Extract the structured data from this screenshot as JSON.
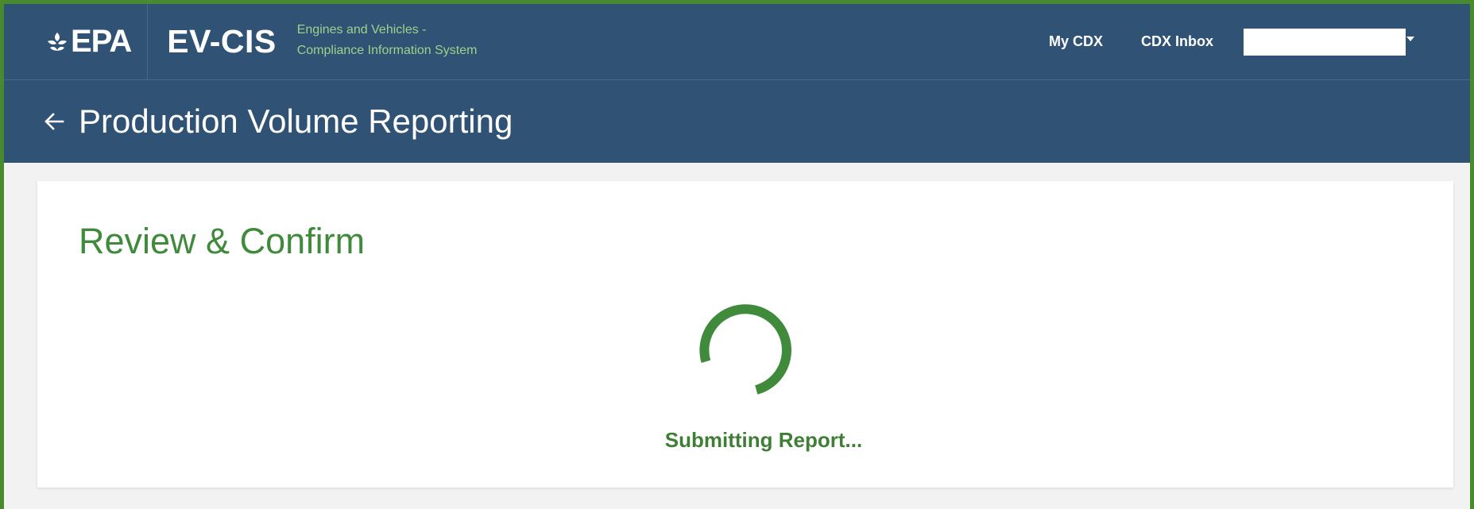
{
  "header": {
    "agency_logo": "EPA",
    "app_name": "EV-CIS",
    "app_subtitle_line1": "Engines and Vehicles -",
    "app_subtitle_line2": "Compliance Information System",
    "nav": {
      "my_cdx": "My CDX",
      "cdx_inbox": "CDX Inbox"
    },
    "user_menu_value": ""
  },
  "page": {
    "back_icon": "arrow-left-icon",
    "title": "Production Volume Reporting"
  },
  "main": {
    "section_title": "Review & Confirm",
    "spinner_icon": "loading-spinner-icon",
    "status_text": "Submitting Report..."
  },
  "colors": {
    "frame_border": "#4a8a2f",
    "header_bg": "#2f5275",
    "subtitle_green": "#9fd18c",
    "accent_green": "#3f8a3b",
    "page_bg": "#f2f2f2"
  }
}
